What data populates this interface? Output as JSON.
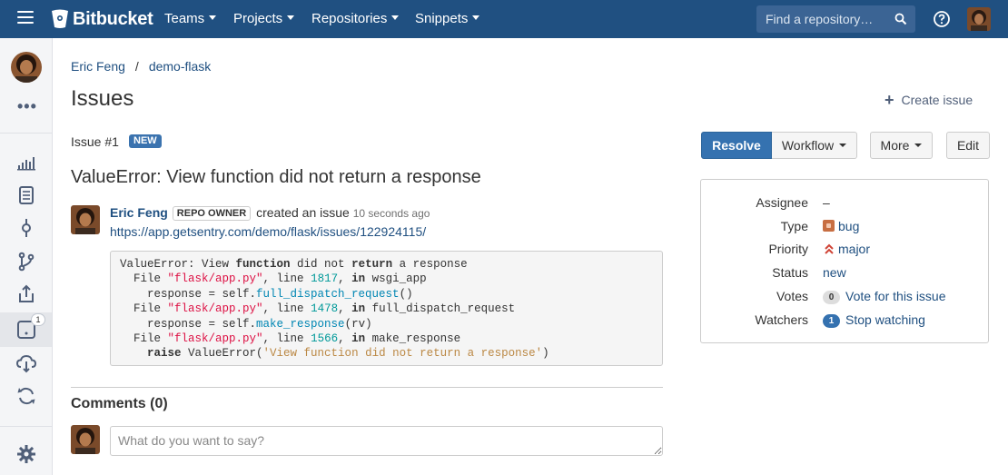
{
  "header": {
    "brand": "Bitbucket",
    "nav": [
      {
        "label": "Teams"
      },
      {
        "label": "Projects"
      },
      {
        "label": "Repositories"
      },
      {
        "label": "Snippets"
      }
    ],
    "search_placeholder": "Find a repository…",
    "colors": {
      "bar": "#205081",
      "search": "#3b6494"
    }
  },
  "sidebar": {
    "issue_count": "1",
    "icons": [
      "avatar",
      "more-icon",
      "overview-icon",
      "source-icon",
      "commits-icon",
      "branches-icon",
      "pull-requests-icon",
      "issues-icon",
      "downloads-icon",
      "pipelines-icon",
      "settings-icon"
    ]
  },
  "breadcrumb": {
    "owner": "Eric Feng",
    "separator": "/",
    "repo": "demo-flask"
  },
  "page": {
    "title": "Issues",
    "create_label": "Create issue"
  },
  "issue": {
    "id_label": "Issue #1",
    "state": "NEW",
    "title": "ValueError: View function did not return a response",
    "actions": {
      "resolve": "Resolve",
      "workflow": "Workflow",
      "more": "More",
      "edit": "Edit"
    },
    "author": "Eric Feng",
    "author_role": "REPO OWNER",
    "action_text": "created an issue",
    "time_ago": "10 seconds ago",
    "link": "https://app.getsentry.com/demo/flask/issues/122924115/",
    "code_lines": [
      "ValueError: View function did not return a response",
      "  File \"flask/app.py\", line 1817, in wsgi_app",
      "    response = self.full_dispatch_request()",
      "  File \"flask/app.py\", line 1478, in full_dispatch_request",
      "    response = self.make_response(rv)",
      "  File \"flask/app.py\", line 1566, in make_response",
      "    raise ValueError('View function did not return a response')"
    ]
  },
  "meta": {
    "assignee_label": "Assignee",
    "assignee": "–",
    "type_label": "Type",
    "type": "bug",
    "priority_label": "Priority",
    "priority": "major",
    "status_label": "Status",
    "status": "new",
    "votes_label": "Votes",
    "votes_count": "0",
    "votes_action": "Vote for this issue",
    "watchers_label": "Watchers",
    "watchers_count": "1",
    "watchers_action": "Stop watching"
  },
  "comments": {
    "title": "Comments (0)",
    "placeholder": "What do you want to say?"
  }
}
